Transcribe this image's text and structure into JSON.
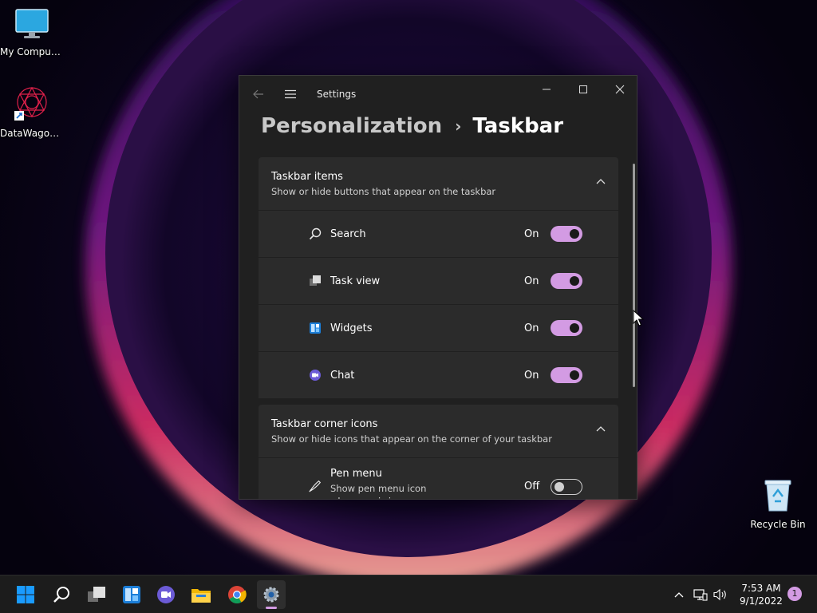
{
  "desktop": {
    "icons": [
      {
        "label": "My Computer"
      },
      {
        "label": "DataWagon..."
      },
      {
        "label": "Recycle Bin"
      }
    ]
  },
  "window": {
    "title": "Settings",
    "breadcrumb": {
      "parent": "Personalization",
      "separator": "›",
      "current": "Taskbar"
    }
  },
  "groups": [
    {
      "title": "Taskbar items",
      "subtitle": "Show or hide buttons that appear on the taskbar",
      "items": [
        {
          "label": "Search",
          "state": "On",
          "icon": "search-icon"
        },
        {
          "label": "Task view",
          "state": "On",
          "icon": "task-view-icon"
        },
        {
          "label": "Widgets",
          "state": "On",
          "icon": "widgets-icon"
        },
        {
          "label": "Chat",
          "state": "On",
          "icon": "chat-icon"
        }
      ]
    },
    {
      "title": "Taskbar corner icons",
      "subtitle": "Show or hide icons that appear on the corner of your taskbar",
      "items": [
        {
          "label": "Pen menu",
          "description": "Show pen menu icon when pen is in use",
          "state": "Off",
          "icon": "pen-icon"
        }
      ]
    }
  ],
  "taskbar": {
    "time": "7:53 AM",
    "date": "9/1/2022",
    "notification_count": "1"
  },
  "colors": {
    "accent": "#d39be3",
    "window_bg": "#202020",
    "card_bg": "#2b2b2b",
    "taskbar_bg": "#1c1c1c"
  }
}
